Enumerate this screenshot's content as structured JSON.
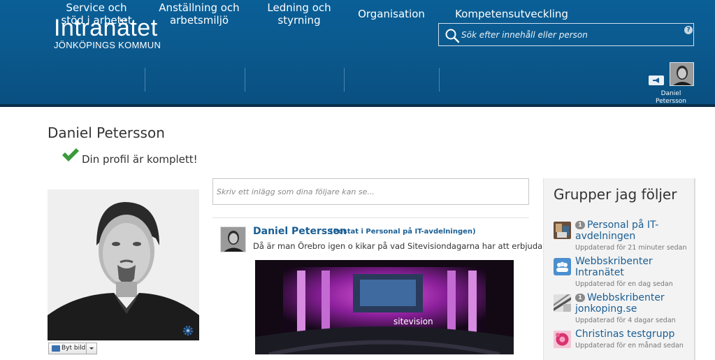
{
  "header": {
    "brand_name": "Intranätet",
    "brand_sub": "JÖNKÖPINGS KOMMUN",
    "search_placeholder": "Sök efter innehåll eller person",
    "help_label": "?",
    "nav": [
      {
        "label": "Service och stöd i arbetet"
      },
      {
        "label": "Anställning och arbetsmiljö"
      },
      {
        "label": "Ledning och styrning"
      },
      {
        "label": "Organisation"
      },
      {
        "label": "Kompetensutveckling"
      }
    ],
    "user_name": "Daniel Petersson"
  },
  "profile": {
    "name": "Daniel Petersson",
    "complete_text": "Din profil är komplett!",
    "change_photo_label": "Byt bild"
  },
  "feed": {
    "post_placeholder": "Skriv ett inlägg som dina följare kan se...",
    "post": {
      "author": "Daniel Petersson",
      "context": "(Postat i Personal på IT-avdelningen)",
      "text": "Då är man Örebro igen o kikar på vad Sitevisiondagarna har att erbjuda.",
      "image_caption": "sitevision"
    }
  },
  "sidebar": {
    "title": "Grupper jag följer",
    "groups": [
      {
        "badge": "1",
        "name": "Personal på IT-avdelningen",
        "updated": "Uppdaterad för 21 minuter sedan"
      },
      {
        "badge": "",
        "name": "Webbskribenter Intranätet",
        "updated": "Uppdaterad för en dag sedan"
      },
      {
        "badge": "1",
        "name": "Webbskribenter jonkoping.se",
        "updated": "Uppdaterad för 4 dagar sedan"
      },
      {
        "badge": "",
        "name": "Christinas testgrupp",
        "updated": "Uppdaterad för en månad sedan"
      }
    ]
  },
  "colors": {
    "header_bg": "#0b5a8f",
    "link_blue": "#1a5e94",
    "check_green": "#3a9a3a"
  },
  "icons": [
    "search-icon",
    "help-icon",
    "megaphone-icon",
    "check-icon",
    "gear-icon",
    "folder-icon",
    "chevron-down-icon",
    "group-icon"
  ]
}
